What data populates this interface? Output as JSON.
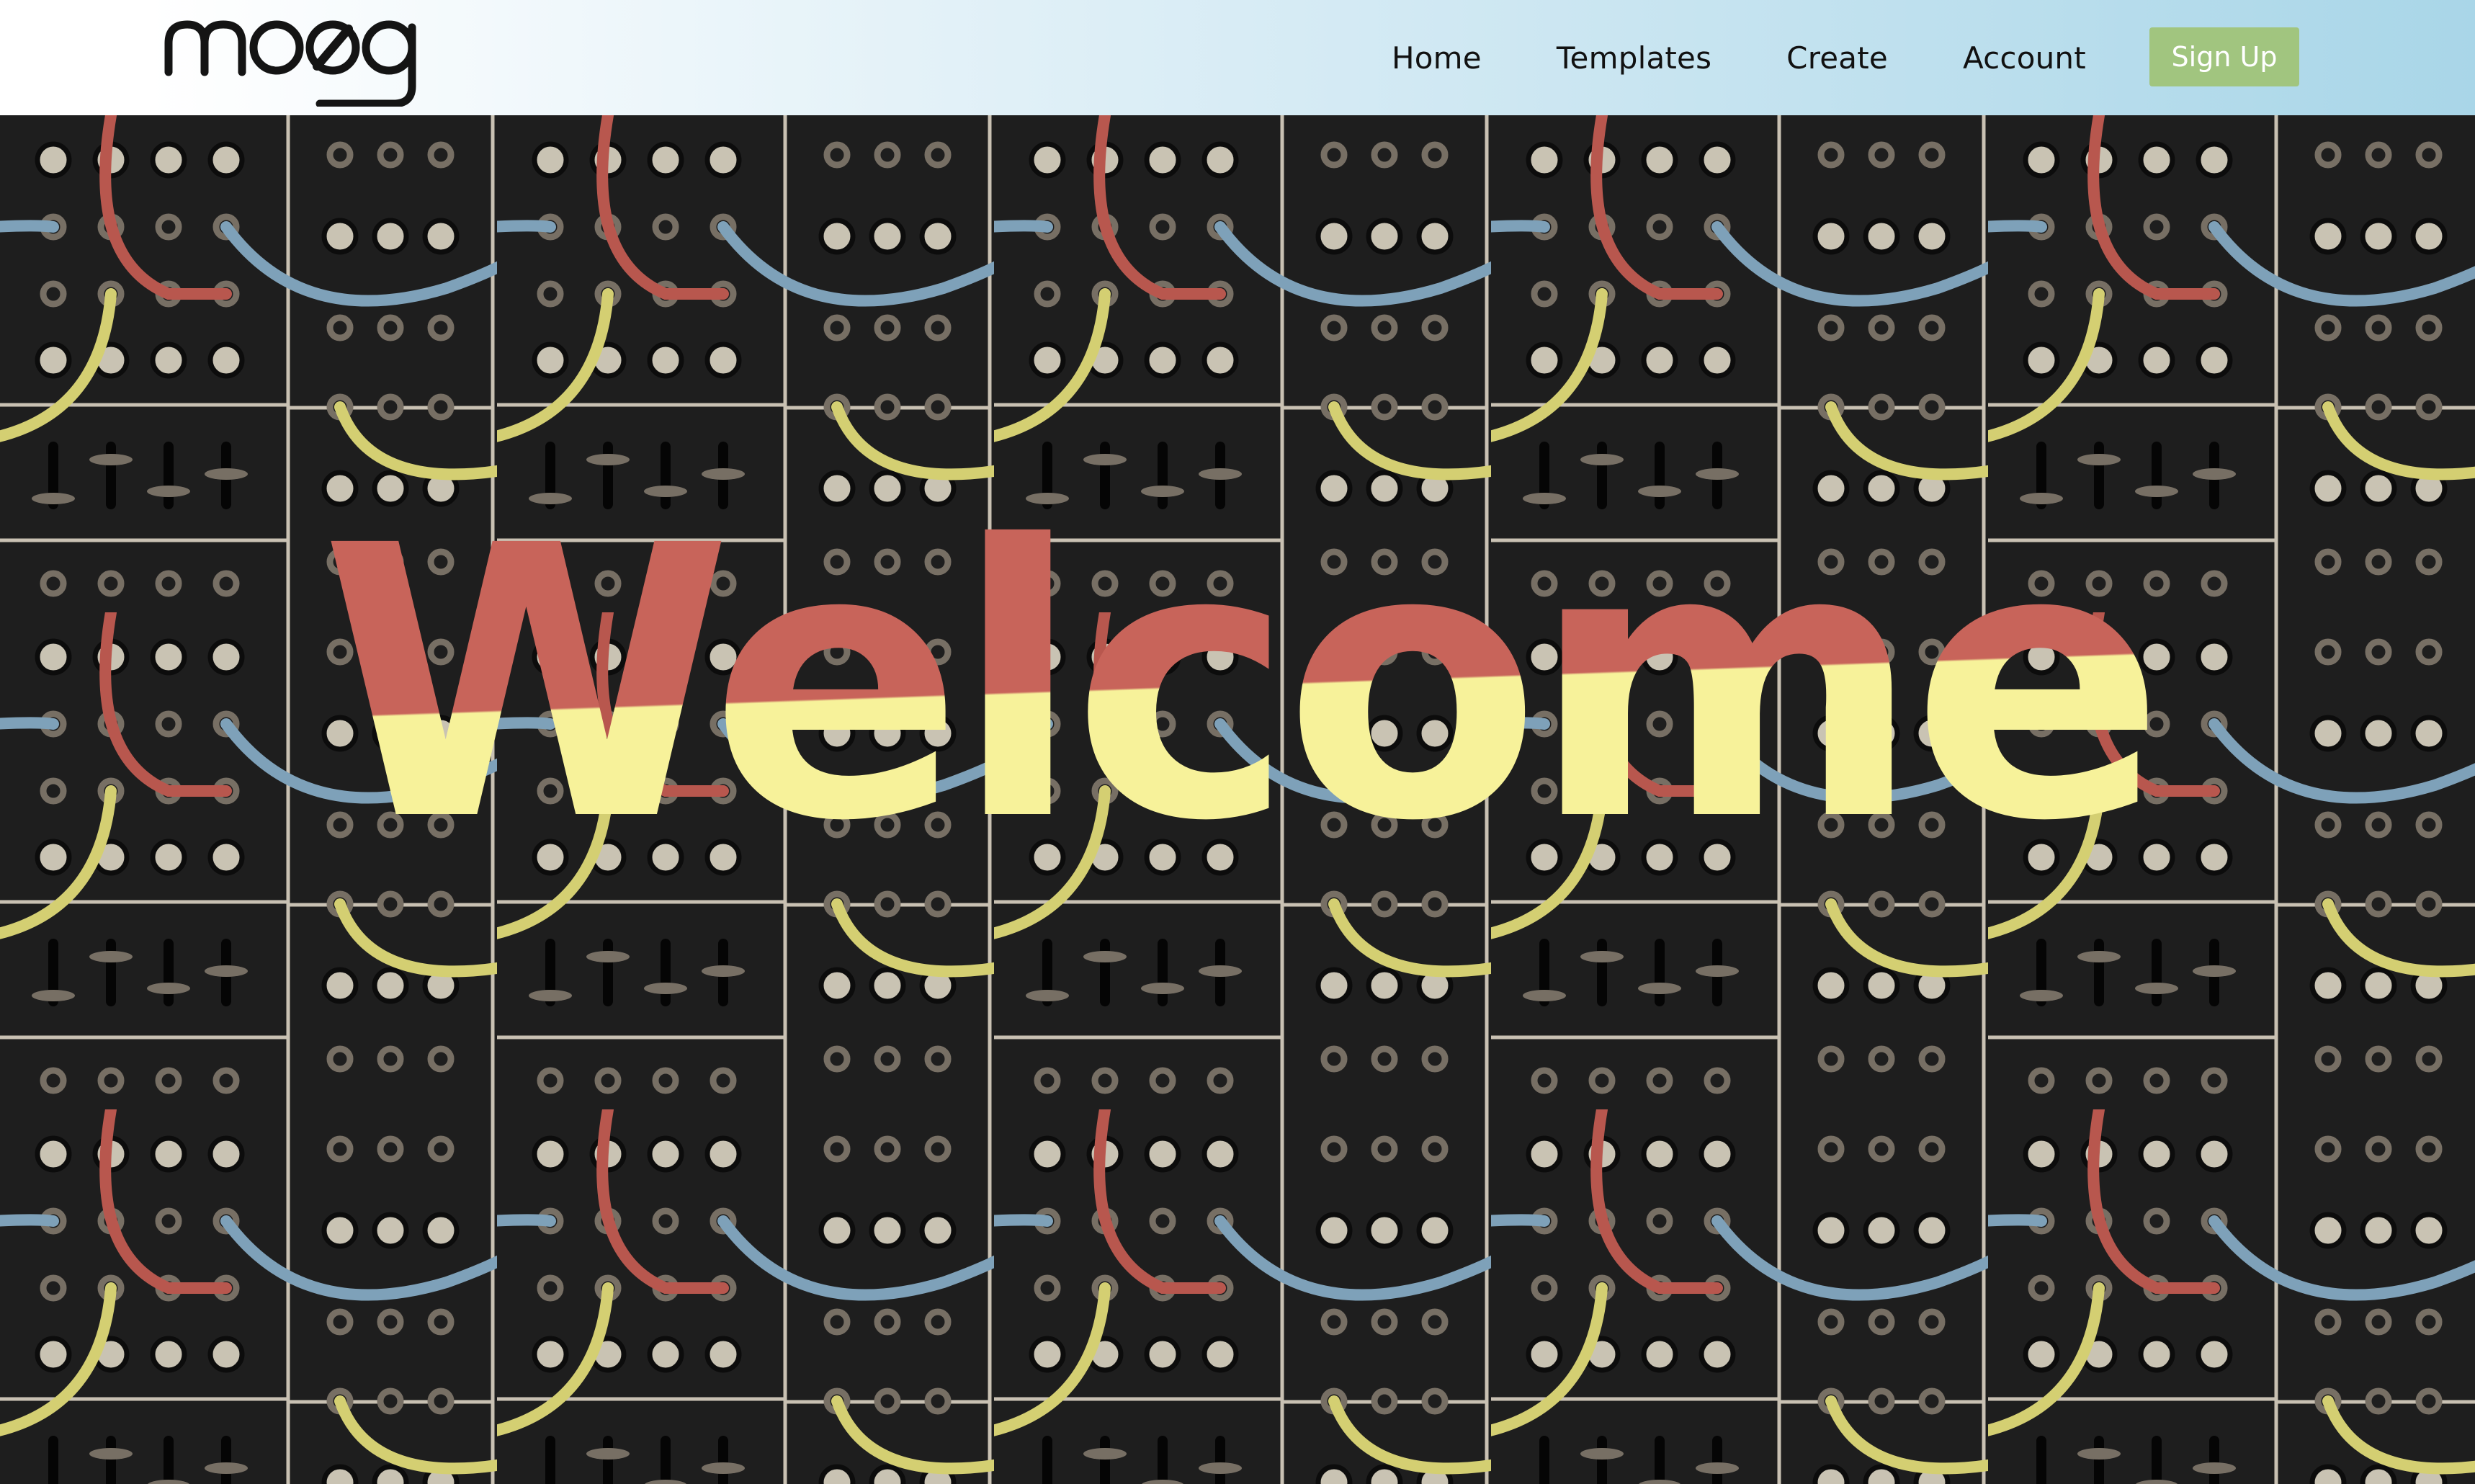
{
  "brand": {
    "logo_text": "moog",
    "colors": {
      "header_start": "#ffffff",
      "header_end": "#a9d6e8",
      "signup_bg": "#a1c57f",
      "panel_bg": "#1e1e1e",
      "panel_line": "#c9c1b3",
      "knob": "#c9c3b3",
      "cable_red": "#b8574e",
      "cable_blue": "#7ea1b9",
      "cable_yellow": "#d4cf72",
      "welcome_top": "#c8645a",
      "welcome_bottom": "#f7f29a"
    }
  },
  "nav": {
    "items": [
      {
        "label": "Home"
      },
      {
        "label": "Templates"
      },
      {
        "label": "Create"
      },
      {
        "label": "Account"
      }
    ],
    "signup_label": "Sign Up"
  },
  "hero": {
    "title": "Welcome",
    "background": "modular-synth-patch-panel-pattern"
  }
}
